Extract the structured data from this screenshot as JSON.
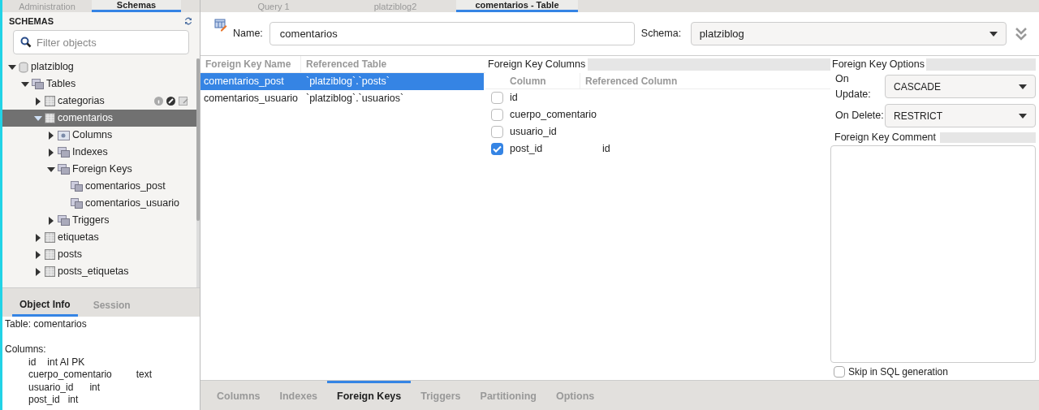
{
  "left_tabs": [
    {
      "label": "Administration",
      "selected": false
    },
    {
      "label": "Schemas",
      "selected": true
    }
  ],
  "schemas": {
    "title": "SCHEMAS",
    "filter_placeholder": "Filter objects",
    "tree": [
      {
        "label": "platziblog",
        "kind": "schema",
        "expanded": true,
        "selected": false,
        "children": [
          {
            "label": "Tables",
            "kind": "folder",
            "expanded": true,
            "selected": false,
            "children": [
              {
                "label": "categorias",
                "kind": "table",
                "expanded": false,
                "selected": false,
                "hover_tools": true
              },
              {
                "label": "comentarios",
                "kind": "table",
                "expanded": true,
                "selected": true,
                "children": [
                  {
                    "label": "Columns",
                    "kind": "columns",
                    "expanded": false,
                    "selected": false
                  },
                  {
                    "label": "Indexes",
                    "kind": "folder",
                    "expanded": false,
                    "selected": false
                  },
                  {
                    "label": "Foreign Keys",
                    "kind": "folder",
                    "expanded": true,
                    "selected": false,
                    "children": [
                      {
                        "label": "comentarios_post",
                        "kind": "fk",
                        "selected": false
                      },
                      {
                        "label": "comentarios_usuario",
                        "kind": "fk",
                        "selected": false
                      }
                    ]
                  },
                  {
                    "label": "Triggers",
                    "kind": "folder",
                    "expanded": false,
                    "selected": false
                  }
                ]
              },
              {
                "label": "etiquetas",
                "kind": "table",
                "expanded": false,
                "selected": false
              },
              {
                "label": "posts",
                "kind": "table",
                "expanded": false,
                "selected": false
              },
              {
                "label": "posts_etiquetas",
                "kind": "table",
                "expanded": false,
                "selected": false
              }
            ]
          }
        ]
      }
    ]
  },
  "info_tabs": [
    {
      "label": "Object Info",
      "selected": true
    },
    {
      "label": "Session",
      "selected": false
    }
  ],
  "object_info": {
    "title": "Table: comentarios",
    "columns_label": "Columns:",
    "columns": [
      {
        "name": "id",
        "type": "int AI PK"
      },
      {
        "name": "cuerpo_comentario",
        "type": "text"
      },
      {
        "name": "usuario_id",
        "type": "int"
      },
      {
        "name": "post_id",
        "type": "int"
      }
    ]
  },
  "editor_tabs": [
    {
      "label": "Query 1",
      "selected": false
    },
    {
      "label": "platziblog2",
      "selected": false
    },
    {
      "label": "comentarios - Table",
      "selected": true
    }
  ],
  "editor": {
    "name_label": "Name:",
    "name_value": "comentarios",
    "schema_label": "Schema:",
    "schema_value": "platziblog"
  },
  "fk_table": {
    "columns": [
      "Foreign Key Name",
      "Referenced Table"
    ],
    "rows": [
      {
        "name": "comentarios_post",
        "ref": "`platziblog`.`posts`",
        "selected": true
      },
      {
        "name": "comentarios_usuario",
        "ref": "`platziblog`.`usuarios`",
        "selected": false
      }
    ]
  },
  "fk_columns": {
    "title": "Foreign Key Columns",
    "columns": [
      "Column",
      "Referenced Column"
    ],
    "rows": [
      {
        "column": "id",
        "checked": false
      },
      {
        "column": "cuerpo_comentario",
        "checked": false
      },
      {
        "column": "usuario_id",
        "checked": false
      },
      {
        "column": "post_id",
        "checked": true,
        "ref": "id"
      }
    ]
  },
  "fk_options": {
    "title": "Foreign Key Options",
    "on_update_label": "On Update:",
    "on_update": "CASCADE",
    "on_delete_label": "On Delete:",
    "on_delete": "RESTRICT",
    "comment_label": "Foreign Key Comment",
    "skip_label": "Skip in SQL generation",
    "skip_checked": false
  },
  "bottom_tabs": [
    {
      "label": "Columns",
      "selected": false
    },
    {
      "label": "Indexes",
      "selected": false
    },
    {
      "label": "Foreign Keys",
      "selected": true
    },
    {
      "label": "Triggers",
      "selected": false
    },
    {
      "label": "Partitioning",
      "selected": false
    },
    {
      "label": "Options",
      "selected": false
    }
  ]
}
